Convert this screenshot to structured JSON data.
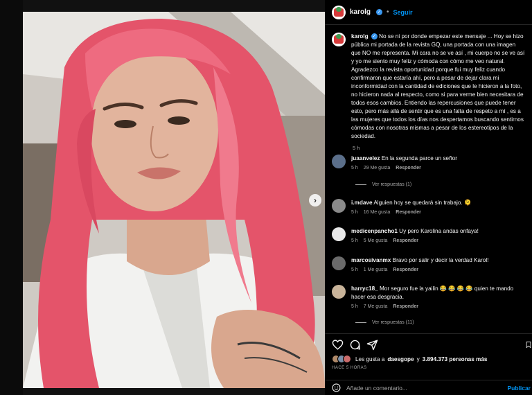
{
  "post": {
    "author": "karolg",
    "follow_label": "Seguir",
    "separator": "•",
    "caption_text": "No se ni por donde empezar este mensaje ... Hoy se hizo pública mi portada de la revista GQ, una portada con una imagen que NO me representa. Mi cara no se ve así , mi cuerpo no se ve así y yo me siento muy feliz y cómoda con cómo me veo natural. Agradezco la revista oportunidad porque fui muy feliz cuando confirmaron que estaría ahí, pero a pesar de dejar clara mi inconformidad con la cantidad de ediciones que le hicieron a la foto, no hicieron nada al respecto, como si para verme bien necesitara de todos esos cambios. Entiendo las repercusiones que puede tener esto, pero más allá de sentir que es una falta de respeto a mí , es a las mujeres que todos los días nos despertamos buscando sentirnos cómodas con nosotras mismas a pesar de los estereotipos de la sociedad.",
    "caption_time": "5 h"
  },
  "comments": [
    {
      "user": "juaanvelez",
      "text": "En la segunda parce un señor",
      "time": "5 h",
      "likes": "29 Me gusta",
      "reply": "Responder",
      "view_replies": "Ver respuestas (1)"
    },
    {
      "user": "i.mdave",
      "text": "Alguien hoy se quedará sin trabajo. 🫠",
      "time": "5 h",
      "likes": "16 Me gusta",
      "reply": "Responder"
    },
    {
      "user": "medicenpancho1",
      "text": "Uy pero Karolina andas onfaya!",
      "time": "5 h",
      "likes": "5 Me gusta",
      "reply": "Responder"
    },
    {
      "user": "marcosivanmx",
      "text": "Bravo por salir y decir la verdad Karol!",
      "time": "5 h",
      "likes": "1 Me gusta",
      "reply": "Responder"
    },
    {
      "user": "harryc18_",
      "text": "Mor seguro fue la yailin 😂 😂 😂 😂  quien te mando hacer esa desgracia.",
      "time": "5 h",
      "likes": "7 Me gusta",
      "reply": "Responder",
      "view_replies": "Ver respuestas (11)"
    }
  ],
  "footer": {
    "likes_prefix": "Les gusta a",
    "likes_user": "daesgope",
    "likes_connector": "y",
    "likes_count": "3.894.373 personas más",
    "posted": "HACE 5 HORAS",
    "comment_placeholder": "Añade un comentario...",
    "post_label": "Publicar"
  },
  "icons": {
    "carousel_next": "›"
  },
  "colors": {
    "accent": "#0095f6",
    "verified": "#3897f0",
    "hair": "#e4546a"
  }
}
